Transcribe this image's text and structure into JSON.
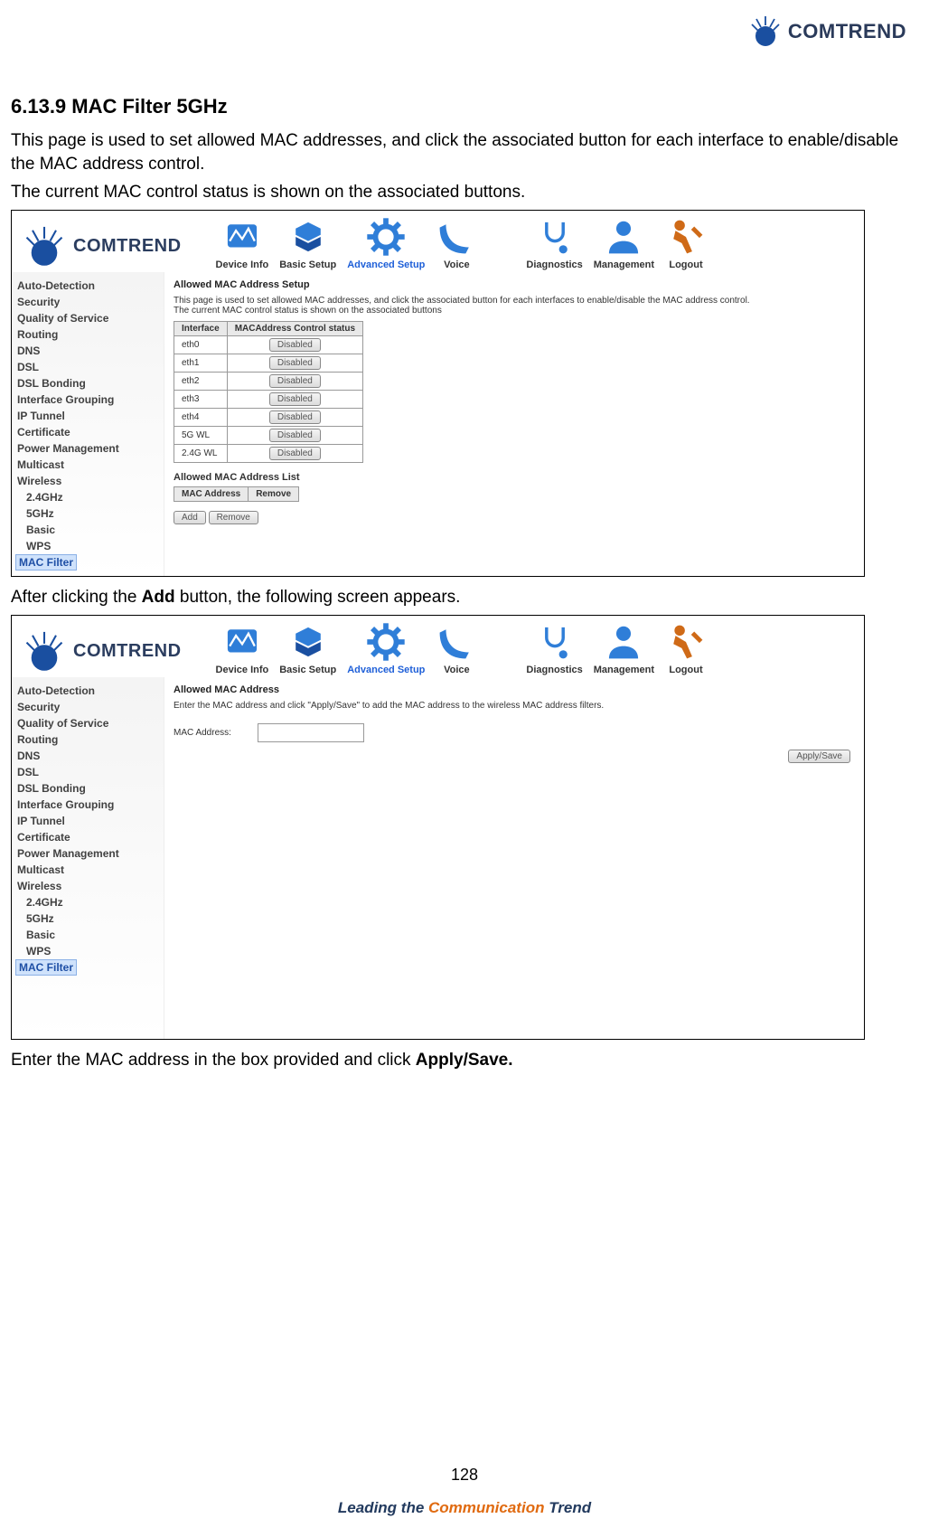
{
  "brand": "COMTREND",
  "page_number": "128",
  "footer": {
    "a": "Leading the ",
    "b": "Communication ",
    "c": "Trend"
  },
  "section": {
    "title": "6.13.9 MAC Filter 5GHz",
    "intro1": "This page is used to set allowed MAC addresses, and click the associated button for each interface to enable/disable the MAC address control.",
    "intro2": "The current MAC control status is shown on the associated buttons.",
    "after": "After clicking the ",
    "after_bold": "Add",
    "after_tail": " button, the following screen appears.",
    "enter": "Enter the MAC address in the box provided and click ",
    "enter_bold": "Apply/Save."
  },
  "nav": [
    {
      "label": "Device Info",
      "active": false
    },
    {
      "label": "Basic Setup",
      "active": false
    },
    {
      "label": "Advanced Setup",
      "active": true
    },
    {
      "label": "Voice",
      "active": false
    },
    {
      "label": "Diagnostics",
      "active": false
    },
    {
      "label": "Management",
      "active": false
    },
    {
      "label": "Logout",
      "active": false
    }
  ],
  "sidebar": [
    {
      "label": "Auto-Detection"
    },
    {
      "label": "Security"
    },
    {
      "label": "Quality of Service"
    },
    {
      "label": "Routing"
    },
    {
      "label": "DNS"
    },
    {
      "label": "DSL"
    },
    {
      "label": "DSL Bonding"
    },
    {
      "label": "Interface Grouping"
    },
    {
      "label": "IP Tunnel"
    },
    {
      "label": "Certificate"
    },
    {
      "label": "Power Management"
    },
    {
      "label": "Multicast"
    },
    {
      "label": "Wireless"
    },
    {
      "label": "2.4GHz",
      "sub": true
    },
    {
      "label": "5GHz",
      "sub": true
    },
    {
      "label": "Basic",
      "sub": true
    },
    {
      "label": "WPS",
      "sub": true
    },
    {
      "label": "MAC Filter",
      "sub": true,
      "active": true
    }
  ],
  "shot1": {
    "heading": "Allowed MAC Address Setup",
    "desc1": "This page is used to set allowed MAC addresses, and click the associated button for each interfaces to enable/disable the MAC address control.",
    "desc2": "The current MAC control status is shown on the associated buttons",
    "table_headers": [
      "Interface",
      "MACAddress Control status"
    ],
    "rows": [
      {
        "if": "eth0",
        "status": "Disabled"
      },
      {
        "if": "eth1",
        "status": "Disabled"
      },
      {
        "if": "eth2",
        "status": "Disabled"
      },
      {
        "if": "eth3",
        "status": "Disabled"
      },
      {
        "if": "eth4",
        "status": "Disabled"
      },
      {
        "if": "5G WL",
        "status": "Disabled"
      },
      {
        "if": "2.4G WL",
        "status": "Disabled"
      }
    ],
    "list_heading": "Allowed MAC Address List",
    "list_headers": [
      "MAC Address",
      "Remove"
    ],
    "add_btn": "Add",
    "remove_btn": "Remove"
  },
  "shot2": {
    "heading": "Allowed MAC Address",
    "desc": "Enter the MAC address and click \"Apply/Save\" to add the MAC address to the wireless MAC address filters.",
    "field_label": "MAC Address:",
    "apply_btn": "Apply/Save"
  }
}
